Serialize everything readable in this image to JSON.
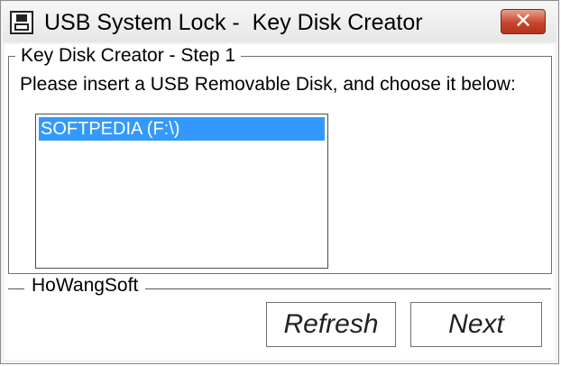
{
  "window": {
    "title": "USB System Lock -  Key Disk Creator",
    "close_label": "✕"
  },
  "group": {
    "title": "Key Disk Creator - Step 1",
    "instruction": "Please insert a USB Removable Disk, and choose it below:",
    "disks": [
      {
        "label": "SOFTPEDIA (F:\\)",
        "selected": true
      }
    ]
  },
  "footer": {
    "company": "HoWangSoft",
    "refresh_label": "Refresh",
    "next_label": "Next"
  },
  "colors": {
    "selection": "#3399ff",
    "close_button": "#c8452c"
  },
  "icons": {
    "app": "floppy-disk-icon",
    "close": "close-icon"
  }
}
